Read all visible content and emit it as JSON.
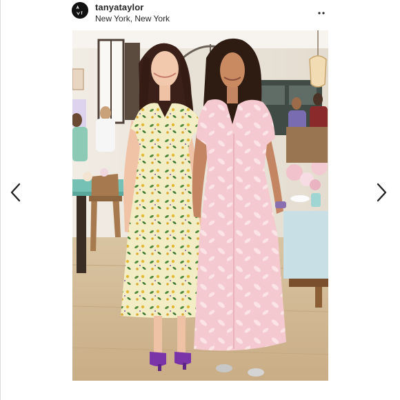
{
  "post": {
    "username": "tanyataylor",
    "location": "New York, New York"
  },
  "icons": {
    "prev": "chevron-left-icon",
    "next": "chevron-right-icon",
    "more": "more-options-icon",
    "avatar": "brand-logo-avatar"
  },
  "colors": {
    "text": "#262626",
    "floral_dress": "#f3edc6",
    "pink_dress": "#f4c9cf",
    "sandals": "#7b33a8"
  }
}
